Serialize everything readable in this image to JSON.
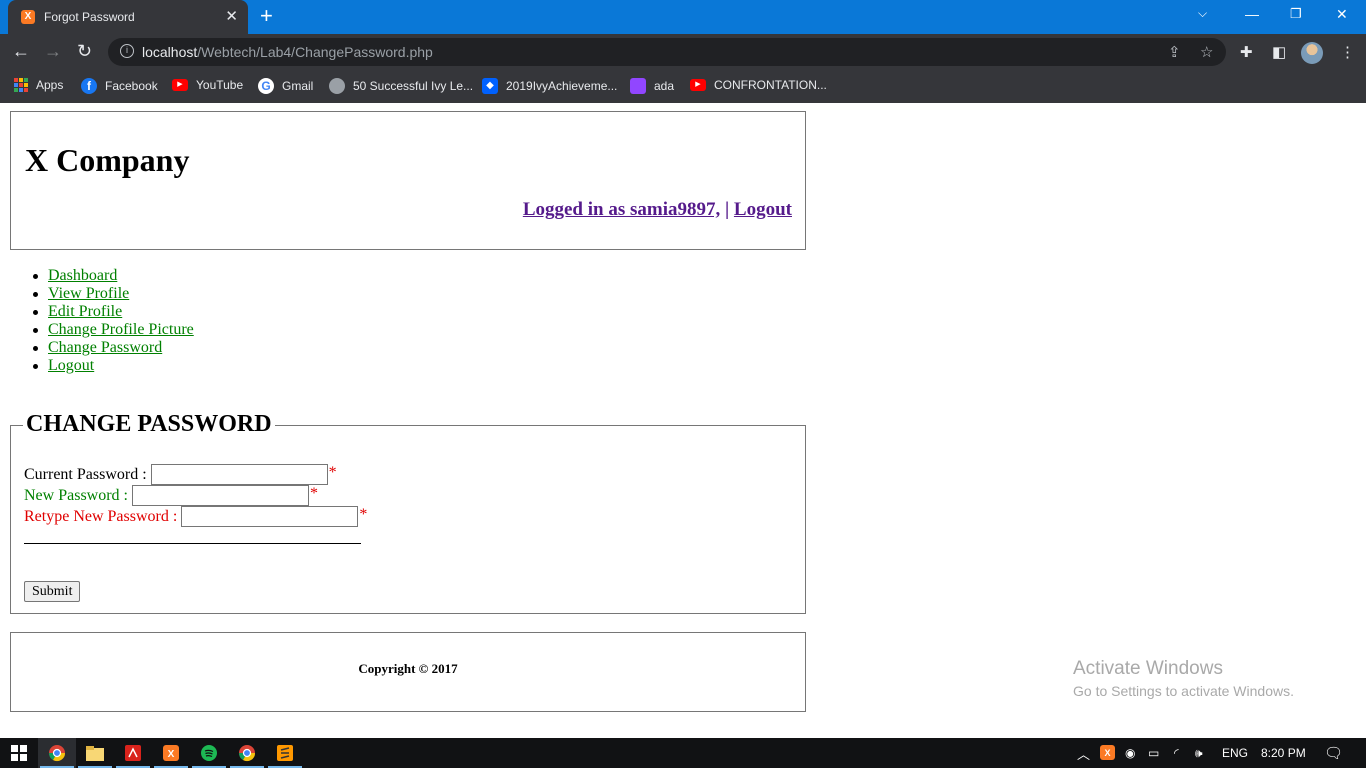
{
  "browser": {
    "tab_title": "Forgot Password",
    "url_host": "localhost",
    "url_path": "/Webtech/Lab4/ChangePassword.php",
    "new_tab": "+",
    "bookmarks": [
      {
        "label": "Apps",
        "icon": "apps-grid-icon"
      },
      {
        "label": "Facebook",
        "icon": "facebook-icon",
        "color": "#1877f2"
      },
      {
        "label": "YouTube",
        "icon": "youtube-icon",
        "color": "#ff0000"
      },
      {
        "label": "Gmail",
        "icon": "google-icon",
        "color": "#ffffff"
      },
      {
        "label": "50 Successful Ivy Le...",
        "icon": "globe-icon",
        "color": "#9aa0a6"
      },
      {
        "label": "2019IvyAchieveme...",
        "icon": "dropbox-icon",
        "color": "#0061fe"
      },
      {
        "label": "ada",
        "icon": "twitch-icon",
        "color": "#9146ff"
      },
      {
        "label": "CONFRONTATION...",
        "icon": "youtube-icon",
        "color": "#ff0000"
      }
    ]
  },
  "header": {
    "company": "X Company",
    "logged_in": "Logged in as samia9897,",
    "separator": "|",
    "logout": "Logout"
  },
  "menu": [
    "Dashboard",
    "View Profile",
    "Edit Profile",
    "Change Profile Picture",
    "Change Password",
    "Logout"
  ],
  "form": {
    "legend": "CHANGE PASSWORD",
    "current_label": "Current Password :",
    "new_label": "New Password :",
    "retype_label": "Retype New Password :",
    "required_mark": "*",
    "submit": "Submit"
  },
  "footer": {
    "copyright": "Copyright © 2017"
  },
  "watermark": {
    "line1": "Activate Windows",
    "line2": "Go to Settings to activate Windows."
  },
  "taskbar": {
    "language": "ENG",
    "time": "8:20 PM"
  },
  "colors": {
    "titlebar": "#0a78d7",
    "chrome_dark": "#35363a",
    "menu_link": "#008000",
    "visited_link": "#551a8b",
    "new_password_label": "#008000",
    "retype_label": "#e00000",
    "required": "#e00000"
  }
}
